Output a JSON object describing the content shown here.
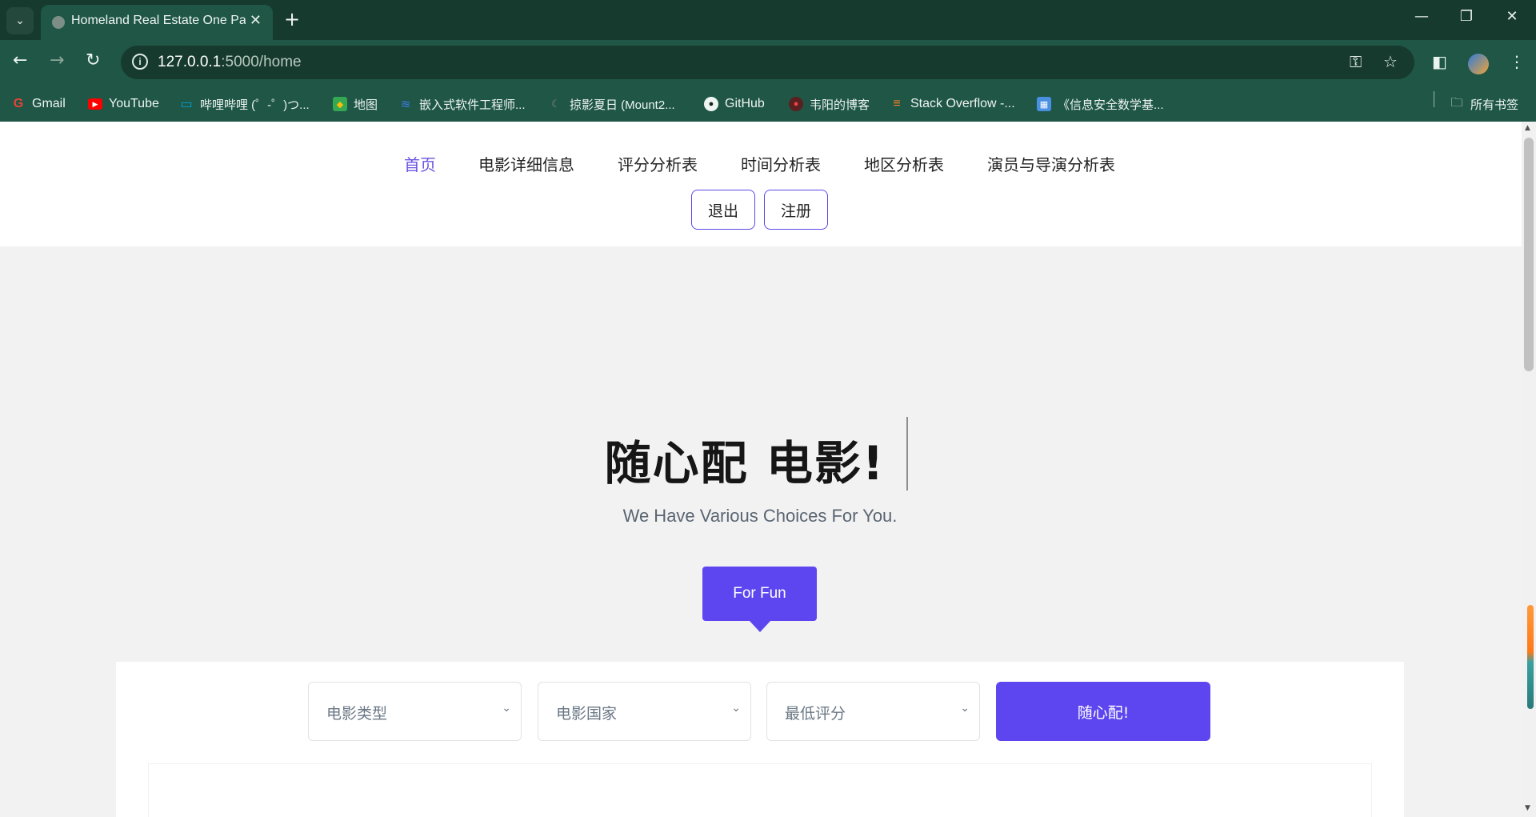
{
  "browser": {
    "tab_title": "Homeland Real Estate One Pa",
    "url_host": "127.0.0.1",
    "url_path": ":5000/home",
    "new_tab_symbol": "+",
    "bookmarks": [
      {
        "label": "Gmail",
        "icon": "gmail-icon",
        "color": "#ea4335",
        "glyph": "G"
      },
      {
        "label": "YouTube",
        "icon": "youtube-icon",
        "color": "#ff0000",
        "glyph": "▶"
      },
      {
        "label": "哔哩哔哩 (゜-゜)つ...",
        "icon": "bilibili-icon",
        "color": "#00a1d6",
        "glyph": "▭"
      },
      {
        "label": "地图",
        "icon": "maps-icon",
        "color": "#34a853",
        "glyph": "◆"
      },
      {
        "label": "嵌入式软件工程师...",
        "icon": "bookmark-icon",
        "color": "#3d7be0",
        "glyph": "≋"
      },
      {
        "label": "掠影夏日 (Mount2...",
        "icon": "bookmark-icon",
        "color": "#8a8a8a",
        "glyph": "☾"
      },
      {
        "label": "GitHub",
        "icon": "github-icon",
        "color": "#1b1f23",
        "glyph": "●"
      },
      {
        "label": "韦阳的博客",
        "icon": "blog-icon",
        "color": "#a33",
        "glyph": "●"
      },
      {
        "label": "Stack Overflow -...",
        "icon": "stackoverflow-icon",
        "color": "#f48024",
        "glyph": "≡"
      },
      {
        "label": "《信息安全数学基...",
        "icon": "bookmark-icon",
        "color": "#4a90e2",
        "glyph": "▦"
      }
    ],
    "all_bookmarks_label": "所有书签"
  },
  "nav": {
    "links": [
      {
        "label": "首页",
        "active": true
      },
      {
        "label": "电影详细信息",
        "active": false
      },
      {
        "label": "评分分析表",
        "active": false
      },
      {
        "label": "时间分析表",
        "active": false
      },
      {
        "label": "地区分析表",
        "active": false
      },
      {
        "label": "演员与导演分析表",
        "active": false
      }
    ],
    "logout_label": "退出",
    "register_label": "注册"
  },
  "hero": {
    "title": "随心配 电影!",
    "subtitle": "We Have Various Choices For You.",
    "fun_button": "For Fun"
  },
  "filters": {
    "genre": "电影类型",
    "country": "电影国家",
    "min_rating": "最低评分",
    "submit": "随心配!"
  },
  "colors": {
    "accent": "#5d46ef",
    "browser_frame": "#1f5646"
  }
}
